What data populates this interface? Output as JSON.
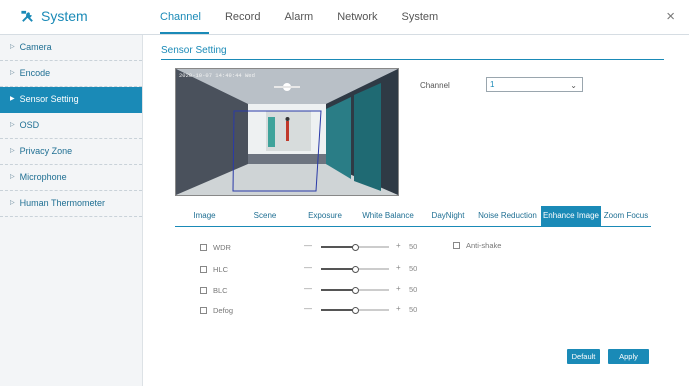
{
  "app": {
    "title": "System"
  },
  "tabs": [
    {
      "label": "Channel"
    },
    {
      "label": "Record"
    },
    {
      "label": "Alarm"
    },
    {
      "label": "Network"
    },
    {
      "label": "System"
    }
  ],
  "close_label": "×",
  "sidebar": {
    "items": [
      {
        "label": "Camera"
      },
      {
        "label": "Encode"
      },
      {
        "label": "Sensor Setting"
      },
      {
        "label": "OSD"
      },
      {
        "label": "Privacy Zone"
      },
      {
        "label": "Microphone"
      },
      {
        "label": "Human Thermometer"
      }
    ]
  },
  "section_title": "Sensor Setting",
  "preview": {
    "timestamp": "2020-10-07 14:49:44 Wed"
  },
  "channel": {
    "label": "Channel",
    "value": "1"
  },
  "subtabs": [
    {
      "label": "Image"
    },
    {
      "label": "Scene"
    },
    {
      "label": "Exposure"
    },
    {
      "label": "White Balance"
    },
    {
      "label": "DayNight"
    },
    {
      "label": "Noise Reduction"
    },
    {
      "label": "Enhance Image"
    },
    {
      "label": "Zoom Focus"
    }
  ],
  "settings": [
    {
      "label": "WDR",
      "value": "50",
      "level": 0.5
    },
    {
      "label": "HLC",
      "value": "50",
      "level": 0.5
    },
    {
      "label": "BLC",
      "value": "50",
      "level": 0.5
    },
    {
      "label": "Defog",
      "value": "50",
      "level": 0.5
    }
  ],
  "slider_minus": "—",
  "slider_plus": "+",
  "antishake": {
    "label": "Anti-shake"
  },
  "buttons": {
    "default": "Default",
    "apply": "Apply"
  },
  "colors": {
    "accent": "#1a8ab7"
  }
}
